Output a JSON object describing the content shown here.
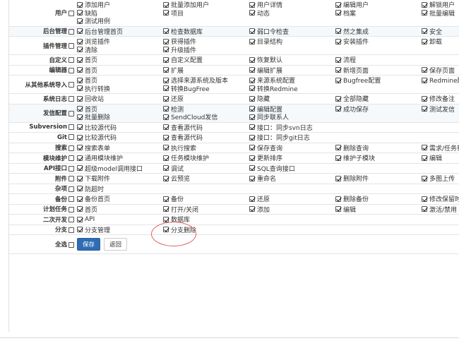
{
  "annotation_color": "#e06060",
  "primary_color": "#2e6db4",
  "modules": [
    {
      "label": "用户",
      "checked": false,
      "items": [
        {
          "label": "添加用户",
          "checked": true
        },
        {
          "label": "批量添加用户",
          "checked": true
        },
        {
          "label": "用户详情",
          "checked": true
        },
        {
          "label": "编辑用户",
          "checked": true
        },
        {
          "label": "解锁用户",
          "checked": true
        },
        {
          "label": "缺陷",
          "checked": true
        },
        {
          "label": "项目",
          "checked": true
        },
        {
          "label": "动态",
          "checked": true
        },
        {
          "label": "档案",
          "checked": true
        },
        {
          "label": "批量编辑",
          "checked": true
        },
        {
          "label": "测试用例",
          "checked": true
        }
      ]
    },
    {
      "label": "后台管理",
      "checked": false,
      "items": [
        {
          "label": "后台管理首页",
          "checked": true
        },
        {
          "label": "检查数据库",
          "checked": true
        },
        {
          "label": "弱口令检查",
          "checked": true
        },
        {
          "label": "然之集成",
          "checked": true
        },
        {
          "label": "安全",
          "checked": true
        }
      ]
    },
    {
      "label": "插件管理",
      "checked": false,
      "items": [
        {
          "label": "浏览插件",
          "checked": true
        },
        {
          "label": "获得插件",
          "checked": true
        },
        {
          "label": "目录结构",
          "checked": true
        },
        {
          "label": "安装插件",
          "checked": true
        },
        {
          "label": "卸载",
          "checked": true
        },
        {
          "label": "清除",
          "checked": true
        },
        {
          "label": "升级插件",
          "checked": true
        }
      ]
    },
    {
      "label": "自定义",
      "checked": false,
      "items": [
        {
          "label": "首页",
          "checked": true
        },
        {
          "label": "自定义配置",
          "checked": true
        },
        {
          "label": "恢复默认",
          "checked": true
        },
        {
          "label": "流程",
          "checked": true
        }
      ]
    },
    {
      "label": "编辑器",
      "checked": false,
      "items": [
        {
          "label": "首页",
          "checked": true
        },
        {
          "label": "扩展",
          "checked": true
        },
        {
          "label": "编辑扩展",
          "checked": true
        },
        {
          "label": "新增页面",
          "checked": true
        },
        {
          "label": "保存页面",
          "checked": true
        }
      ]
    },
    {
      "label": "从其他系统导入",
      "checked": false,
      "items": [
        {
          "label": "首页",
          "checked": true
        },
        {
          "label": "选择来源系统及版本",
          "checked": true
        },
        {
          "label": "来源系统配置",
          "checked": true
        },
        {
          "label": "Bugfree配置",
          "checked": true
        },
        {
          "label": "Redmine配置",
          "checked": true
        },
        {
          "label": "执行转换",
          "checked": true
        },
        {
          "label": "转换BugFree",
          "checked": true
        },
        {
          "label": "转换Redmine",
          "checked": true
        }
      ]
    },
    {
      "label": "系统日志",
      "checked": false,
      "items": [
        {
          "label": "回收站",
          "checked": true
        },
        {
          "label": "还原",
          "checked": true
        },
        {
          "label": "隐藏",
          "checked": true
        },
        {
          "label": "全部隐藏",
          "checked": true
        },
        {
          "label": "修改备注",
          "checked": true
        }
      ]
    },
    {
      "label": "发信配置",
      "checked": false,
      "items": [
        {
          "label": "首页",
          "checked": true
        },
        {
          "label": "检测",
          "checked": true
        },
        {
          "label": "编辑配置",
          "checked": true
        },
        {
          "label": "成功保存",
          "checked": true
        },
        {
          "label": "测试发信",
          "checked": true
        },
        {
          "label": "批量删除",
          "checked": true
        },
        {
          "label": "SendCloud发信",
          "checked": true
        },
        {
          "label": "同步联系人",
          "checked": true
        }
      ]
    },
    {
      "label": "Subversion",
      "checked": false,
      "items": [
        {
          "label": "比较源代码",
          "checked": true
        },
        {
          "label": "查看源代码",
          "checked": true
        },
        {
          "label": "接口：同步svn日志",
          "checked": true
        }
      ]
    },
    {
      "label": "Git",
      "checked": false,
      "items": [
        {
          "label": "比较源代码",
          "checked": true
        },
        {
          "label": "查看源代码",
          "checked": true
        },
        {
          "label": "接口：同步git日志",
          "checked": true
        }
      ]
    },
    {
      "label": "搜索",
      "checked": false,
      "items": [
        {
          "label": "搜索表单",
          "checked": true
        },
        {
          "label": "执行搜索",
          "checked": true
        },
        {
          "label": "保存查询",
          "checked": true
        },
        {
          "label": "删除查询",
          "checked": true
        },
        {
          "label": "需求/任务筛",
          "checked": true
        }
      ]
    },
    {
      "label": "模块维护",
      "checked": false,
      "items": [
        {
          "label": "通用模块维护",
          "checked": true
        },
        {
          "label": "任务模块维护",
          "checked": true
        },
        {
          "label": "更新排序",
          "checked": true
        },
        {
          "label": "维护子模块",
          "checked": true
        },
        {
          "label": "编辑",
          "checked": true
        }
      ]
    },
    {
      "label": "API接口",
      "checked": false,
      "items": [
        {
          "label": "超级model调用接口",
          "checked": true
        },
        {
          "label": "调试",
          "checked": true
        },
        {
          "label": "SQL查询接口",
          "checked": true
        }
      ]
    },
    {
      "label": "附件",
      "checked": false,
      "items": [
        {
          "label": "下载附件",
          "checked": true
        },
        {
          "label": "云预览",
          "checked": true
        },
        {
          "label": "重命名",
          "checked": true
        },
        {
          "label": "删除附件",
          "checked": true
        },
        {
          "label": "多图上传",
          "checked": true
        }
      ]
    },
    {
      "label": "杂项",
      "checked": false,
      "items": [
        {
          "label": "防超时",
          "checked": true
        }
      ]
    },
    {
      "label": "备份",
      "checked": false,
      "items": [
        {
          "label": "备份首页",
          "checked": true
        },
        {
          "label": "备份",
          "checked": true
        },
        {
          "label": "还原",
          "checked": true
        },
        {
          "label": "删除备份",
          "checked": true
        },
        {
          "label": "修改保留时间",
          "checked": true
        }
      ]
    },
    {
      "label": "计划任务",
      "checked": false,
      "items": [
        {
          "label": "首页",
          "checked": true
        },
        {
          "label": "打开/关闭",
          "checked": true
        },
        {
          "label": "添加",
          "checked": true
        },
        {
          "label": "编辑",
          "checked": true
        },
        {
          "label": "激活/禁用",
          "checked": true
        }
      ]
    },
    {
      "label": "二次开发",
      "checked": false,
      "items": [
        {
          "label": "API",
          "checked": true
        },
        {
          "label": "数据库",
          "checked": true
        }
      ]
    },
    {
      "label": "分支",
      "checked": false,
      "items": [
        {
          "label": "分支管理",
          "checked": true
        },
        {
          "label": "分支删除",
          "checked": true
        }
      ]
    }
  ],
  "select_all": {
    "label": "全选",
    "checked": false
  },
  "buttons": {
    "save": "保存",
    "back": "返回"
  }
}
